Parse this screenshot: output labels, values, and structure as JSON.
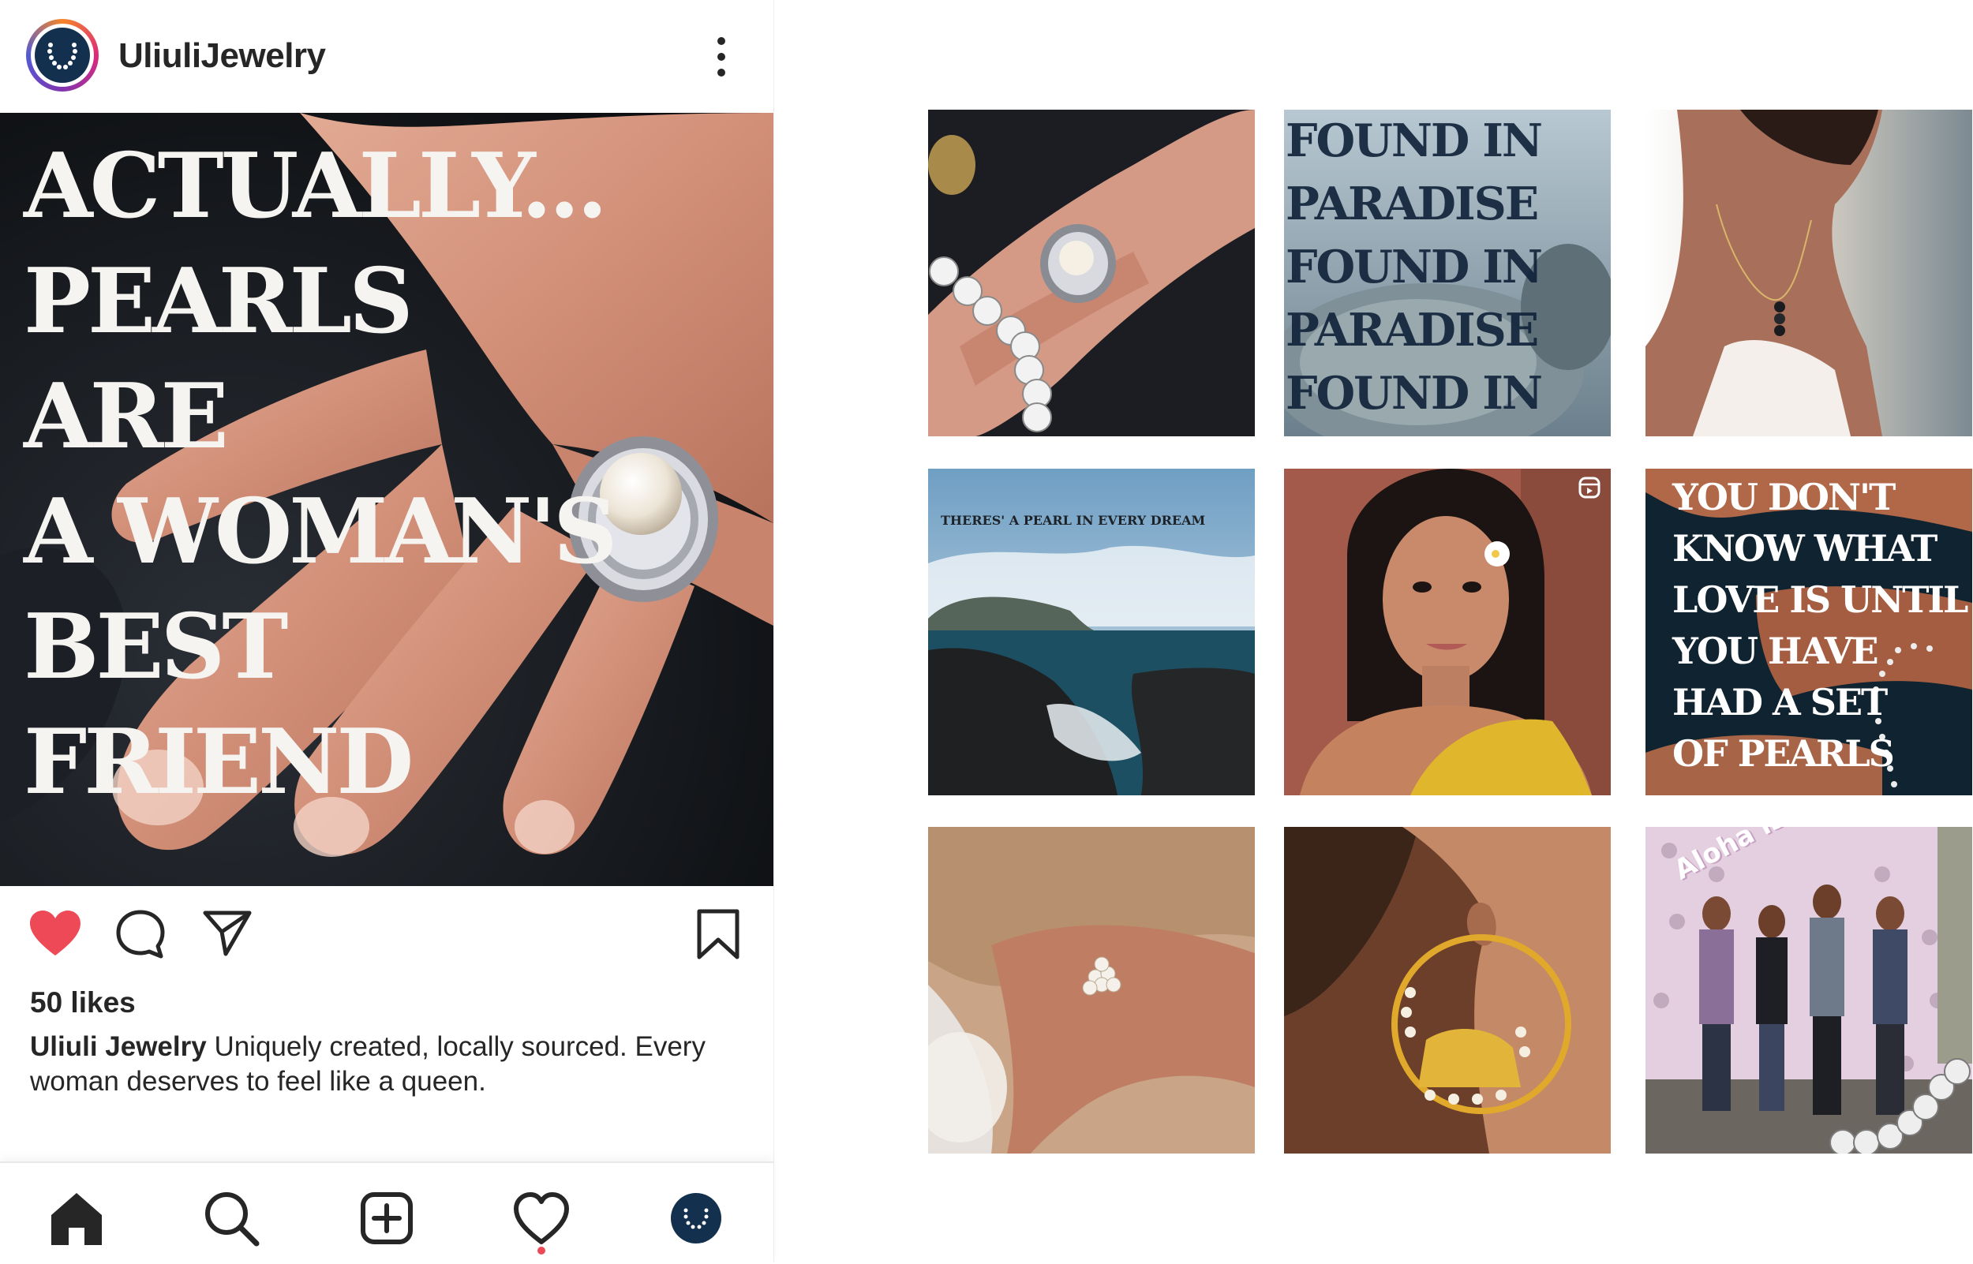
{
  "post": {
    "account_name": "UliuliJewelry",
    "headline": "ACTUALLY...\nPEARLS ARE\nA WOMAN'S\nBEST FRIEND",
    "likes": "50 likes",
    "caption_user": "Uliuli Jewelry",
    "caption_text": " Uniquely created, locally sourced. Every woman deserves to feel like a queen.",
    "liked": true,
    "icons": [
      "heart-icon",
      "comment-icon",
      "share-icon",
      "bookmark-icon",
      "more-options-icon"
    ]
  },
  "bottom_nav": {
    "items": [
      "home",
      "search",
      "create",
      "activity",
      "profile"
    ],
    "activity_has_notification": true
  },
  "grid": {
    "tile_1": {
      "subject": "pearl ring on hand"
    },
    "tile_2": {
      "text": "FOUND IN\nPARADISE\nFOUND IN\nPARADISE\nFOUND IN"
    },
    "tile_3": {
      "subject": "black pearl necklace"
    },
    "tile_4": {
      "text": "THERES' A PEARL IN EVERY DREAM"
    },
    "tile_5": {
      "subject": "woman with flower in hair",
      "badge": "reel-icon"
    },
    "tile_6": {
      "text": "YOU DON'T\nKNOW WHAT\nLOVE IS UNTIL\nYOU HAVE\nHAD A SET\nOF PEARLS"
    },
    "tile_7": {
      "subject": "pearl flower ring in sea foam"
    },
    "tile_8": {
      "subject": "pearl hoop earring"
    },
    "tile_9": {
      "wall_text": "Aloha is Love"
    }
  },
  "colors": {
    "like_red": "#ed4956",
    "text_dark": "#262626",
    "avatar_navy": "#14304f"
  }
}
